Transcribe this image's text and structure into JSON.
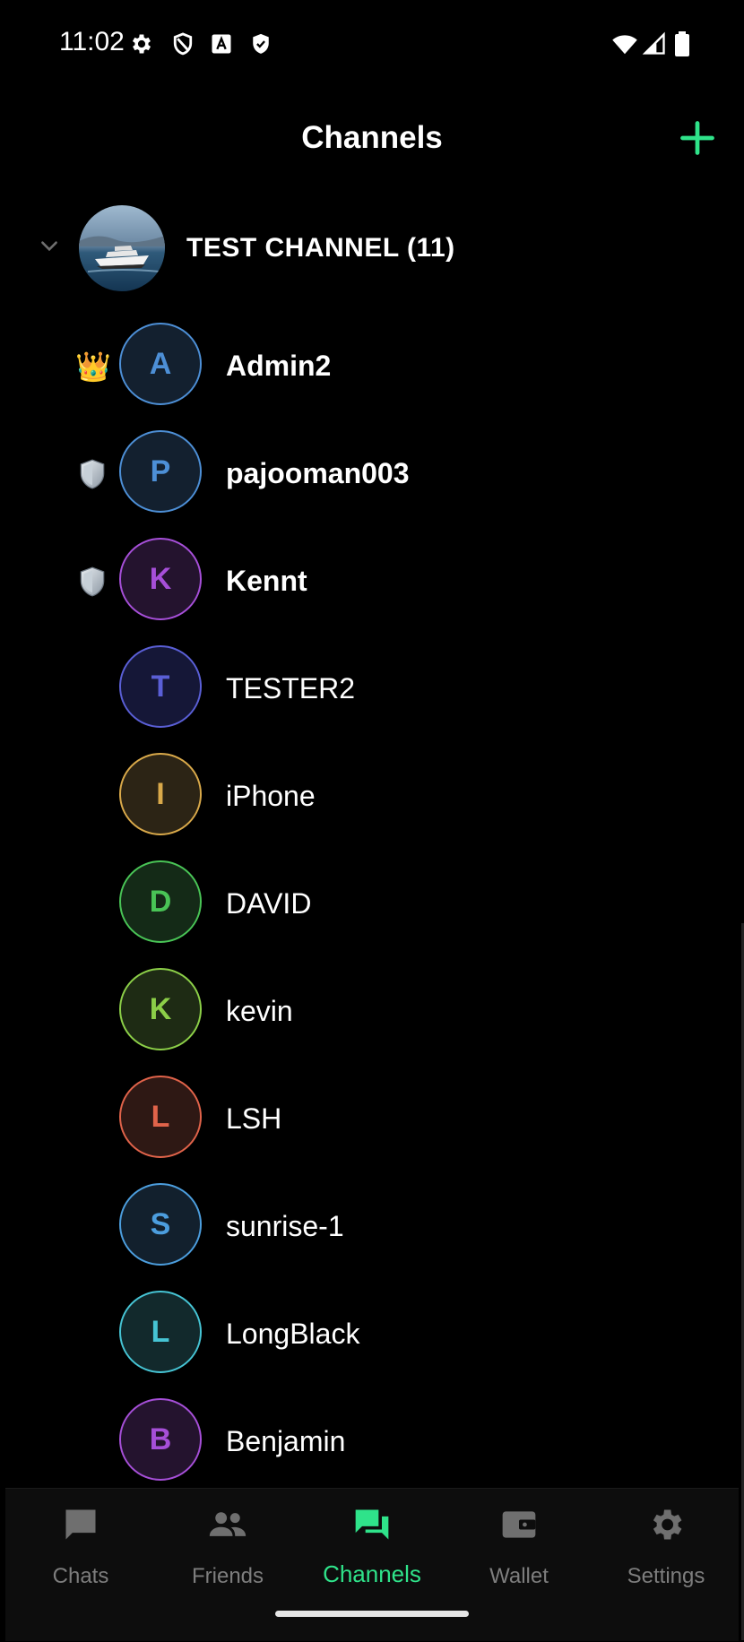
{
  "status_bar": {
    "time": "11:02",
    "left_icons": [
      "gear-icon",
      "shield-outline-icon",
      "font-a-icon",
      "shield-check-icon"
    ],
    "right_icons": [
      "wifi-icon",
      "cellular-signal-icon",
      "battery-icon"
    ]
  },
  "header": {
    "title": "Channels",
    "add_icon": "plus-icon",
    "accent_color": "#2fe38a"
  },
  "channel": {
    "name": "TEST CHANNEL (11)",
    "expanded": true
  },
  "members": [
    {
      "initial": "A",
      "name": "Admin2",
      "role": "owner",
      "role_icon": "👑",
      "bold": true,
      "color": "#4d8fd6",
      "bg": "#13202f"
    },
    {
      "initial": "P",
      "name": "pajooman003",
      "role": "moderator",
      "role_icon": "shield-icon",
      "bold": true,
      "color": "#4d8fd6",
      "bg": "#13202f"
    },
    {
      "initial": "K",
      "name": "Kennt",
      "role": "moderator",
      "role_icon": "shield-icon",
      "bold": true,
      "color": "#a64fd8",
      "bg": "#24132e"
    },
    {
      "initial": "T",
      "name": "TESTER2",
      "role": "",
      "role_icon": "",
      "bold": false,
      "color": "#5a5fd6",
      "bg": "#151737"
    },
    {
      "initial": "I",
      "name": "iPhone",
      "role": "",
      "role_icon": "",
      "bold": false,
      "color": "#d9a94a",
      "bg": "#2c2415"
    },
    {
      "initial": "D",
      "name": "DAVID",
      "role": "",
      "role_icon": "",
      "bold": false,
      "color": "#49c456",
      "bg": "#142a17"
    },
    {
      "initial": "K",
      "name": "kevin",
      "role": "",
      "role_icon": "",
      "bold": false,
      "color": "#8ccf48",
      "bg": "#1e2b14"
    },
    {
      "initial": "L",
      "name": "LSH",
      "role": "",
      "role_icon": "",
      "bold": false,
      "color": "#e0634a",
      "bg": "#2e1814"
    },
    {
      "initial": "S",
      "name": "sunrise-1",
      "role": "",
      "role_icon": "",
      "bold": false,
      "color": "#4c9ede",
      "bg": "#12202d"
    },
    {
      "initial": "L",
      "name": "LongBlack",
      "role": "",
      "role_icon": "",
      "bold": false,
      "color": "#46c4d4",
      "bg": "#12292c"
    },
    {
      "initial": "B",
      "name": "Benjamin",
      "role": "",
      "role_icon": "",
      "bold": false,
      "color": "#a64fd8",
      "bg": "#24132e"
    }
  ],
  "bottom_nav": {
    "active": "Channels",
    "items": [
      {
        "label": "Chats",
        "icon": "chat-bubble-icon"
      },
      {
        "label": "Friends",
        "icon": "people-icon"
      },
      {
        "label": "Channels",
        "icon": "channels-icon"
      },
      {
        "label": "Wallet",
        "icon": "wallet-icon"
      },
      {
        "label": "Settings",
        "icon": "gear-icon"
      }
    ]
  }
}
